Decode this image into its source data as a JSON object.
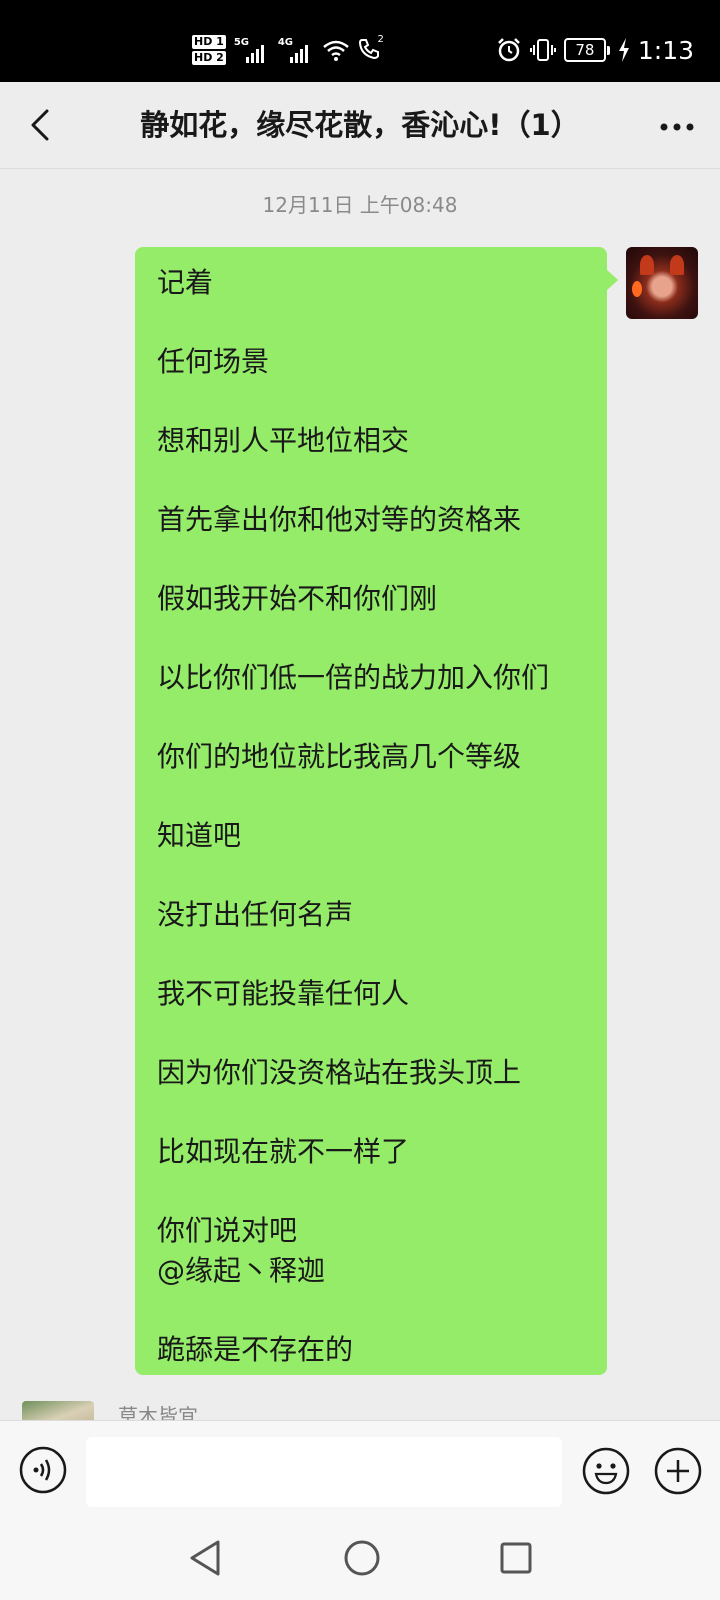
{
  "status_bar": {
    "hd1": "HD 1",
    "hd2": "HD 2",
    "net1": "5G",
    "net2": "4G",
    "call_superscript": "2",
    "battery": "78",
    "time": "1:13",
    "icons": [
      "alarm-icon",
      "vibrate-icon",
      "wifi-icon",
      "hd-call-icon",
      "charging-icon"
    ]
  },
  "header": {
    "title": "静如花，缘尽花散，香沁心!（1）",
    "back_icon": "chevron-left-icon",
    "more_icon": "more-dots-icon"
  },
  "chat": {
    "timestamp": "12月11日 上午08:48",
    "message": {
      "lines": [
        "记着",
        "任何场景",
        "想和别人平地位相交",
        "首先拿出你和他对等的资格来",
        "假如我开始不和你们刚",
        "以比你们低一倍的战力加入你们",
        "你们的地位就比我高几个等级",
        "知道吧",
        "没打出任何名声",
        "我不可能投靠任何人",
        "因为你们没资格站在我头顶上",
        "比如现在就不一样了",
        "你们说对吧",
        "@缘起丶释迦",
        "跪舔是不存在的"
      ]
    },
    "next_sender_name": "草木皆宜"
  },
  "input_bar": {
    "placeholder": "",
    "voice_icon": "voice-icon",
    "emoji_icon": "emoji-icon",
    "plus_icon": "plus-icon"
  },
  "nav": {
    "icons": [
      "nav-back-icon",
      "nav-home-icon",
      "nav-recent-icon"
    ]
  },
  "colors": {
    "bubble_green": "#95ec69",
    "background": "#ededed",
    "status_bar": "#000000"
  }
}
